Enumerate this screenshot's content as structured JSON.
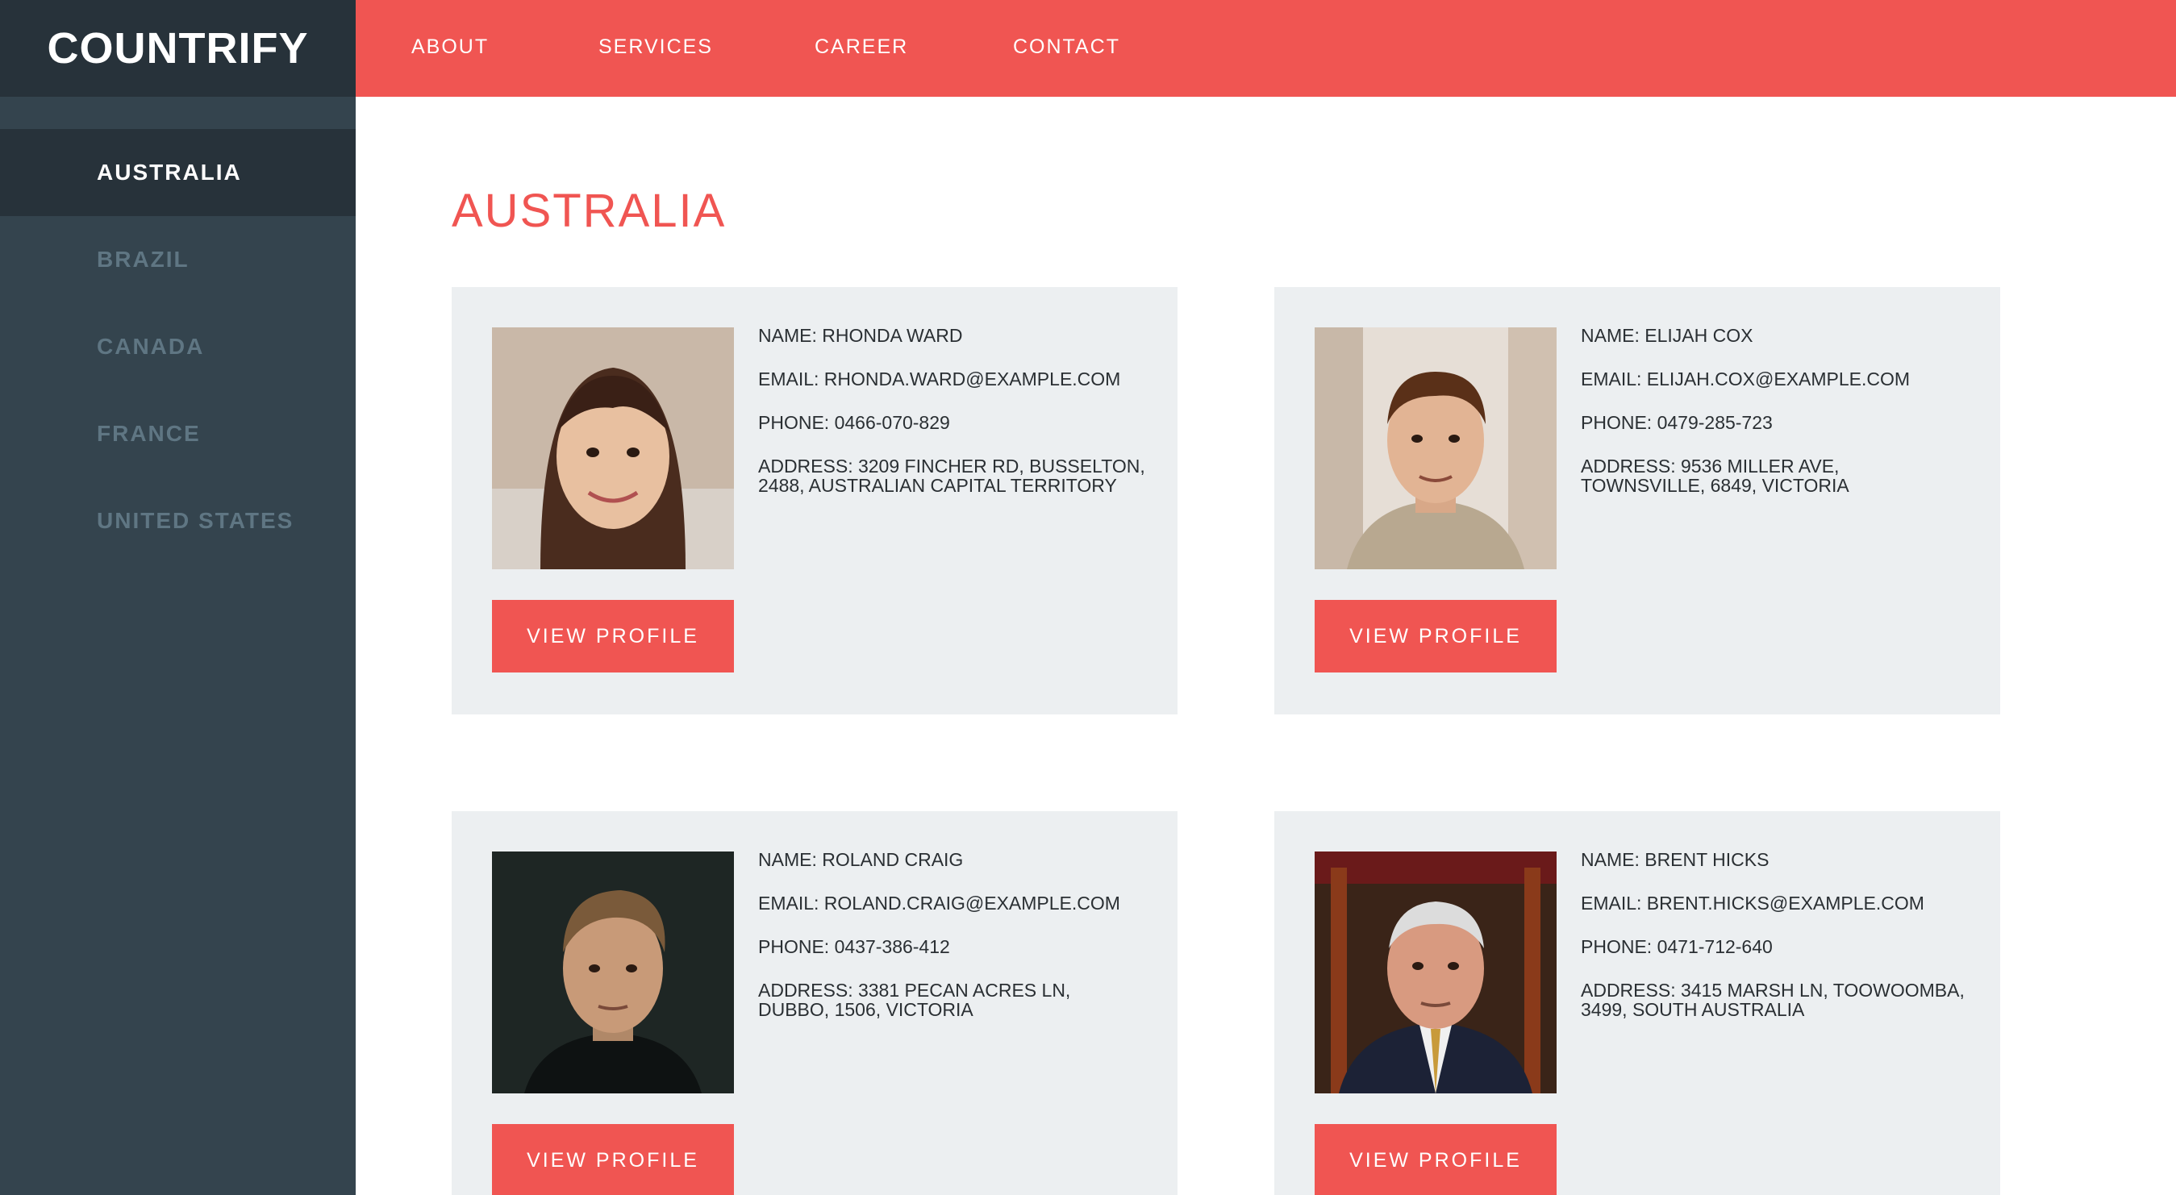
{
  "brand": {
    "logo": "COUNTRIFY"
  },
  "topnav": [
    "ABOUT",
    "SERVICES",
    "CAREER",
    "CONTACT"
  ],
  "sidebar": {
    "items": [
      {
        "label": "AUSTRALIA",
        "active": true
      },
      {
        "label": "BRAZIL",
        "active": false
      },
      {
        "label": "CANADA",
        "active": false
      },
      {
        "label": "FRANCE",
        "active": false
      },
      {
        "label": "UNITED STATES",
        "active": false
      }
    ]
  },
  "main": {
    "title": "AUSTRALIA",
    "cards": [
      {
        "name": "NAME: RHONDA WARD",
        "email": "EMAIL: RHONDA.WARD@EXAMPLE.COM",
        "phone": "PHONE: 0466-070-829",
        "address": "ADDRESS: 3209 FINCHER RD, BUSSELTON, 2488, AUSTRALIAN CAPITAL TERRITORY",
        "button": "VIEW PROFILE"
      },
      {
        "name": "NAME: ELIJAH COX",
        "email": "EMAIL: ELIJAH.COX@EXAMPLE.COM",
        "phone": "PHONE: 0479-285-723",
        "address": "ADDRESS: 9536 MILLER AVE, TOWNSVILLE, 6849, VICTORIA",
        "button": "VIEW PROFILE"
      },
      {
        "name": "NAME: ROLAND CRAIG",
        "email": "EMAIL: ROLAND.CRAIG@EXAMPLE.COM",
        "phone": "PHONE: 0437-386-412",
        "address": "ADDRESS: 3381 PECAN ACRES LN, DUBBO, 1506, VICTORIA",
        "button": "VIEW PROFILE"
      },
      {
        "name": "NAME: BRENT HICKS",
        "email": "EMAIL: BRENT.HICKS@EXAMPLE.COM",
        "phone": "PHONE: 0471-712-640",
        "address": "ADDRESS: 3415 MARSH LN, TOOWOOMBA, 3499, SOUTH AUSTRALIA",
        "button": "VIEW PROFILE"
      }
    ]
  },
  "colors": {
    "accent": "#f05552",
    "sidebar": "#34444e",
    "sidebar_dark": "#27323a",
    "card": "#eceff1"
  }
}
